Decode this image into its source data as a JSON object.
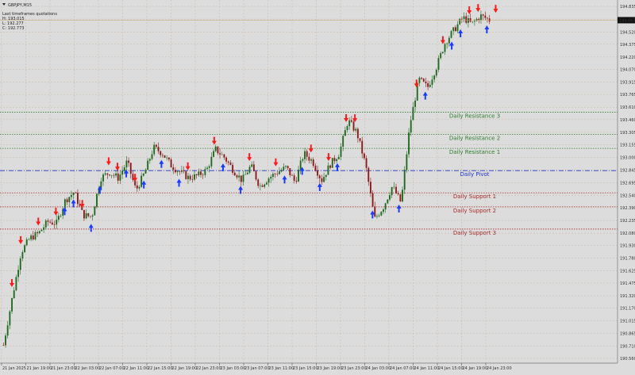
{
  "symbol": "GBPJPY,M15",
  "info": {
    "line1": "Last timeframes quotations",
    "high": "H: 193.015",
    "low": "L: 192.277",
    "close": "C: 192.773"
  },
  "colors": {
    "background": "#dcdcdc",
    "grid": "#c9b9a6",
    "bull": "#1f6a1f",
    "bear": "#8a1a1a",
    "resistance": "#2e7d2e",
    "pivot": "#2233cc",
    "support": "#a52a2a",
    "buy_arrow": "#1a3bff",
    "sell_arrow": "#ff1a1a"
  },
  "price_axis": {
    "min": 190.56,
    "max": 194.835,
    "ticks": [
      "194.835",
      "194.680",
      "194.520",
      "194.375",
      "194.220",
      "194.070",
      "193.915",
      "193.765",
      "193.610",
      "193.460",
      "193.305",
      "193.155",
      "193.000",
      "192.845",
      "192.695",
      "192.540",
      "192.390",
      "192.235",
      "192.080",
      "191.930",
      "191.780",
      "191.625",
      "191.475",
      "191.320",
      "191.170",
      "191.015",
      "190.865",
      "190.710",
      "190.560"
    ],
    "current_price": "194.667"
  },
  "time_axis": {
    "labels": [
      "21 Jan 2025",
      "21 Jan 19:00",
      "21 Jan 23:00",
      "22 Jan 03:00",
      "22 Jan 07:00",
      "22 Jan 11:00",
      "22 Jan 15:00",
      "22 Jan 19:00",
      "22 Jan 23:00",
      "23 Jan 03:00",
      "23 Jan 07:00",
      "23 Jan 11:00",
      "23 Jan 15:00",
      "23 Jan 19:00",
      "23 Jan 23:00",
      "24 Jan 03:00",
      "24 Jan 07:00",
      "24 Jan 11:00",
      "24 Jan 15:00",
      "24 Jan 19:00",
      "24 Jan 23:00"
    ]
  },
  "levels": [
    {
      "name": "Daily Resistance 3",
      "price": 193.55,
      "label_price": "193.545",
      "kind": "resistance"
    },
    {
      "name": "Daily Resistance 2",
      "price": 193.28,
      "label_price": "193.144",
      "kind": "resistance"
    },
    {
      "name": "Daily Resistance 1",
      "price": 193.11,
      "label_price": "192.976",
      "kind": "resistance"
    },
    {
      "name": "Daily Pivot",
      "price": 192.84,
      "label_price": "192.688",
      "kind": "pivot"
    },
    {
      "name": "Daily Support 1",
      "price": 192.57,
      "label_price": "192.466",
      "kind": "support"
    },
    {
      "name": "Daily Support 2",
      "price": 192.4,
      "label_price": "192.232",
      "kind": "support"
    },
    {
      "name": "Daily Support 3",
      "price": 192.13,
      "label_price": "191.998",
      "kind": "support"
    }
  ],
  "chart_data": {
    "type": "candlestick",
    "x": [
      "21 Jan 2025",
      "21 Jan 19:00",
      "21 Jan 23:00",
      "22 Jan 03:00",
      "22 Jan 07:00",
      "22 Jan 11:00",
      "22 Jan 15:00",
      "22 Jan 19:00",
      "22 Jan 23:00",
      "23 Jan 03:00",
      "23 Jan 07:00",
      "23 Jan 11:00",
      "23 Jan 15:00",
      "23 Jan 19:00",
      "23 Jan 23:00",
      "24 Jan 03:00",
      "24 Jan 07:00",
      "24 Jan 11:00",
      "24 Jan 15:00",
      "24 Jan 19:00",
      "24 Jan 23:00"
    ],
    "close_path": [
      190.72,
      191.3,
      191.85,
      192.02,
      192.08,
      192.22,
      192.2,
      192.48,
      192.58,
      192.3,
      192.28,
      192.75,
      192.82,
      192.75,
      192.95,
      192.6,
      192.82,
      193.12,
      193.05,
      192.9,
      192.82,
      192.75,
      192.78,
      192.85,
      193.1,
      193.0,
      192.85,
      192.72,
      192.9,
      192.65,
      192.75,
      192.82,
      192.88,
      192.7,
      193.05,
      192.95,
      192.72,
      192.92,
      193.05,
      193.45,
      193.3,
      192.9,
      192.25,
      192.4,
      192.65,
      192.45,
      193.4,
      193.95,
      193.85,
      194.1,
      194.4,
      194.55,
      194.7,
      194.62,
      194.72,
      194.67
    ],
    "sell_arrows_x_index": [
      0,
      1,
      3,
      5,
      8,
      11,
      12,
      14,
      20,
      23,
      27,
      30,
      34,
      36,
      38,
      39,
      46,
      49,
      52,
      53,
      55
    ],
    "buy_arrows_x_index": [
      6,
      7,
      9,
      10,
      13,
      15,
      17,
      19,
      24,
      26,
      31,
      33,
      35,
      37,
      41,
      44,
      47,
      50,
      51,
      54
    ]
  }
}
